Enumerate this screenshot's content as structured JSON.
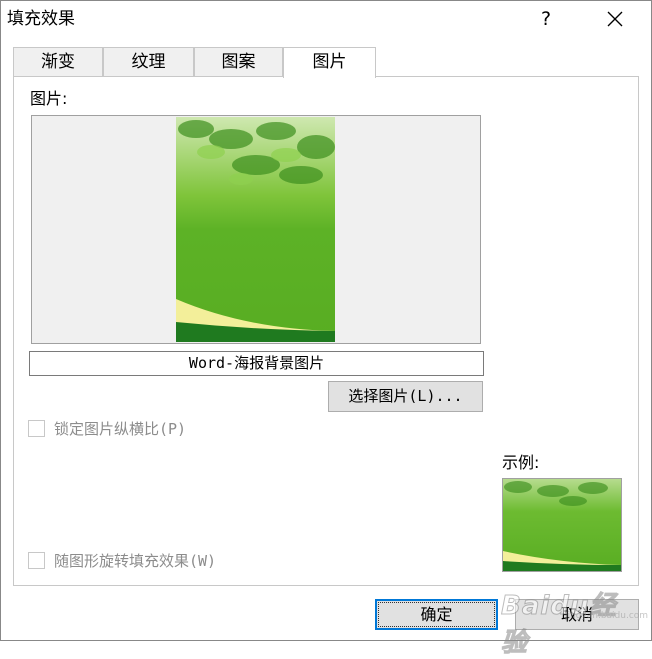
{
  "dialog": {
    "title": "填充效果",
    "help_glyph": "?",
    "close_glyph": "✕"
  },
  "tabs": [
    {
      "label": "渐变",
      "active": false
    },
    {
      "label": "纹理",
      "active": false
    },
    {
      "label": "图案",
      "active": false
    },
    {
      "label": "图片",
      "active": true
    }
  ],
  "picture": {
    "label": "图片:",
    "file_name": "Word-海报背景图片",
    "select_button": "选择图片(L)...",
    "lock_aspect_label": "锁定图片纵横比(P)",
    "lock_aspect_checked": false,
    "rotate_with_shape_label": "随图形旋转填充效果(W)",
    "rotate_with_shape_checked": false
  },
  "sample": {
    "label": "示例:"
  },
  "buttons": {
    "ok": "确定",
    "cancel": "取消"
  },
  "watermark": {
    "text": "Baidu经验",
    "sub": "jingyan.baidu.com"
  },
  "colors": {
    "poster_green": "#5db226",
    "poster_dark_green": "#1f7a1f",
    "poster_yellow": "#f3ef9a",
    "focus_blue": "#0078d7"
  }
}
